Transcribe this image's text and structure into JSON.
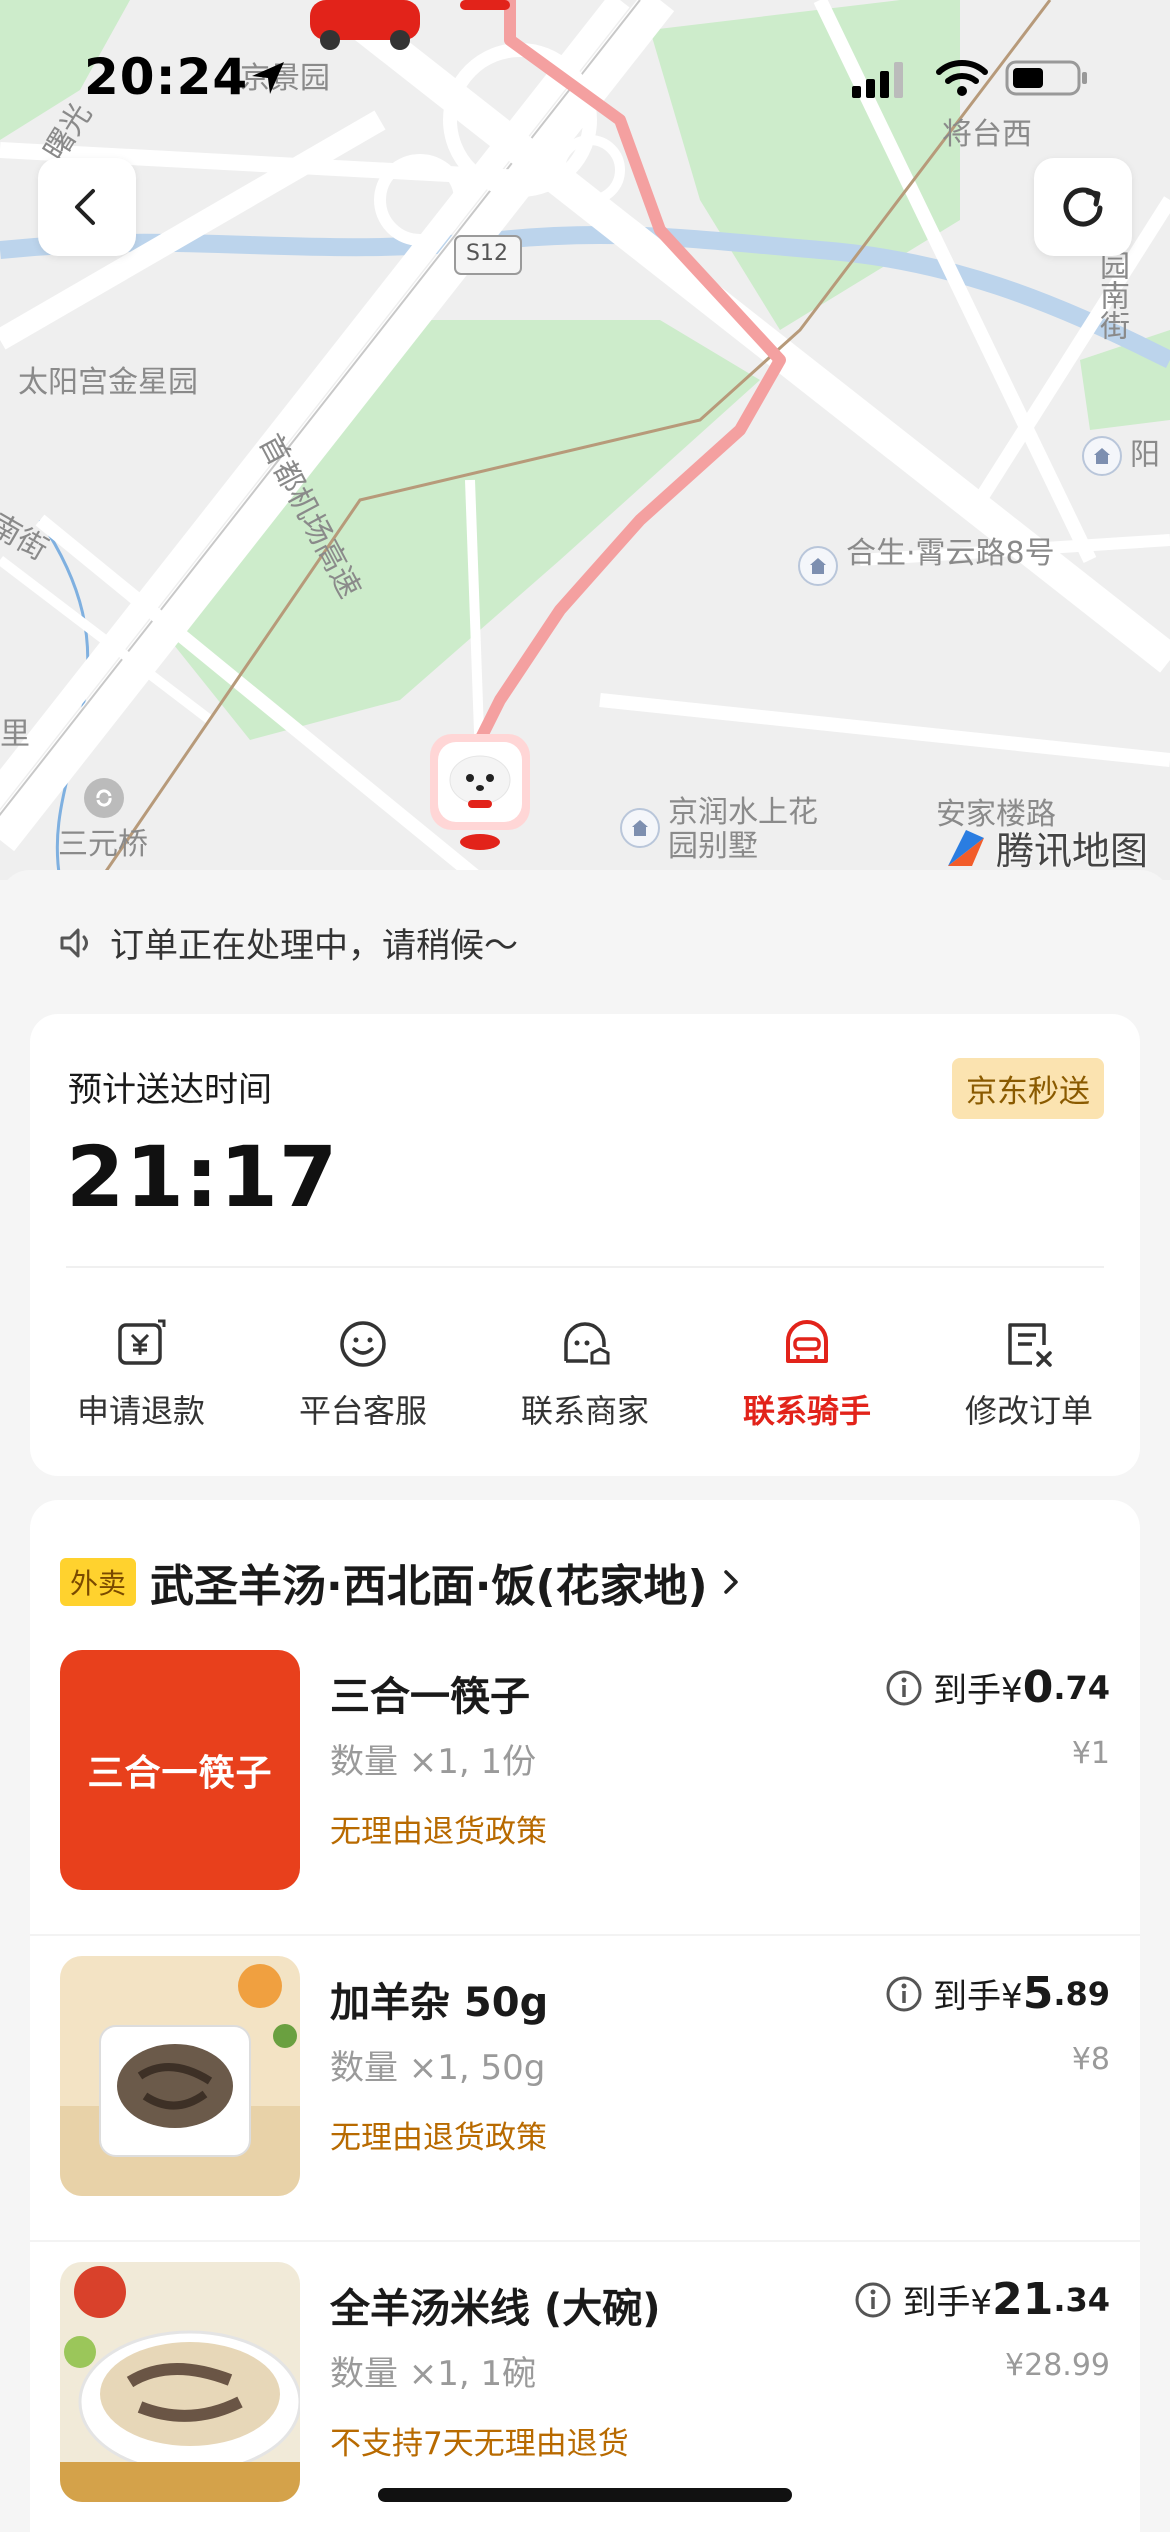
{
  "status_bar": {
    "time": "20:24"
  },
  "map": {
    "labels": {
      "jingjingyuan": "京景园",
      "jiangtaixi": "将台西",
      "s12": "S12",
      "taiyanggong": "太阳宫金星园",
      "airport_expressway": "首都机场高速",
      "nanjie_left": "南街",
      "yuannanjie": "园南街",
      "yang": "阳",
      "hesheng": "合生·霄云路8号",
      "li": "里",
      "sanyuanqiao": "三元桥",
      "jingrun": "京润水上花园别墅",
      "anjialoulu": "安家楼路",
      "shuguang": "曙光"
    },
    "attribution": "腾讯地图"
  },
  "notice": "订单正在处理中，请稍候～",
  "eta": {
    "label": "预计送达时间",
    "time": "21:17",
    "badge": "京东秒送"
  },
  "actions": [
    {
      "label": "申请退款",
      "icon": "refund-icon"
    },
    {
      "label": "平台客服",
      "icon": "customer-service-icon"
    },
    {
      "label": "联系商家",
      "icon": "merchant-icon"
    },
    {
      "label": "联系骑手",
      "icon": "rider-icon",
      "active": true
    },
    {
      "label": "修改订单",
      "icon": "edit-order-icon"
    }
  ],
  "order": {
    "tag": "外卖",
    "store_name": "武圣羊汤·西北面·饭(花家地)",
    "price_prefix": "到手¥",
    "items": [
      {
        "name": "三合一筷子",
        "thumb_text": "三合一筷子",
        "qty": "数量 ×1, 1份",
        "policy": "无理由退货政策",
        "price_int": "0",
        "price_dec": ".74",
        "orig": "¥1"
      },
      {
        "name": "加羊杂 50g",
        "qty": "数量 ×1, 50g",
        "policy": "无理由退货政策",
        "price_int": "5",
        "price_dec": ".89",
        "orig": "¥8"
      },
      {
        "name": "全羊汤米线 (大碗)",
        "qty": "数量 ×1, 1碗",
        "policy": "不支持7天无理由退货",
        "price_int": "21",
        "price_dec": ".34",
        "orig": "¥28.99"
      }
    ]
  },
  "colors": {
    "accent_red": "#e2231a",
    "policy_orange": "#b86a00",
    "badge_bg": "#fbe3b0",
    "tag_yellow": "#ffd22e",
    "route_pink": "#f4a0a0"
  }
}
